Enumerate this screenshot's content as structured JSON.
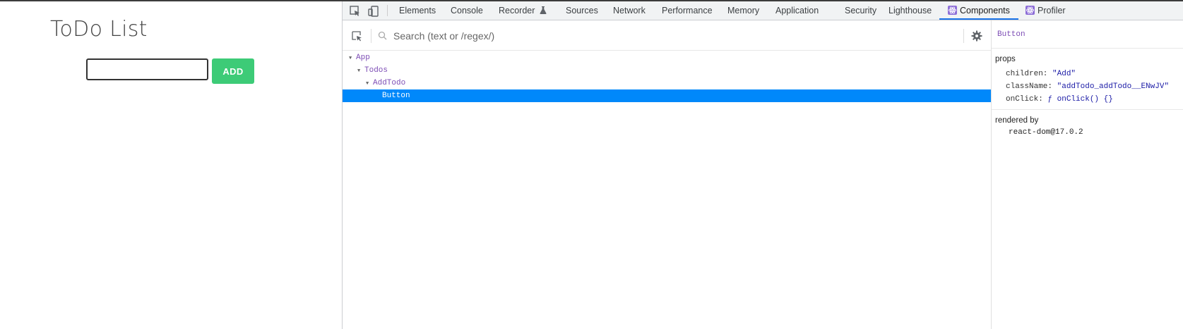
{
  "app": {
    "title": "ToDo List",
    "input_value": "",
    "add_label": "ADD",
    "accent_color": "#3dcb77"
  },
  "devtools": {
    "tabs": [
      {
        "label": "Elements"
      },
      {
        "label": "Console"
      },
      {
        "label": "Recorder"
      },
      {
        "label": "Sources"
      },
      {
        "label": "Network"
      },
      {
        "label": "Performance"
      },
      {
        "label": "Memory"
      },
      {
        "label": "Application"
      },
      {
        "label": "Security"
      },
      {
        "label": "Lighthouse"
      },
      {
        "label": "Components"
      },
      {
        "label": "Profiler"
      }
    ],
    "active_tab": "Components",
    "recorder_icon": "flask-icon",
    "search": {
      "placeholder": "Search (text or /regex/)"
    },
    "tree": [
      {
        "label": "App",
        "expanded": true
      },
      {
        "label": "Todos",
        "expanded": true
      },
      {
        "label": "AddTodo",
        "expanded": true
      },
      {
        "label": "Button",
        "selected": true
      }
    ],
    "selected_color": "#0088fa",
    "props_panel": {
      "component": "Button",
      "props_title": "props",
      "props": [
        {
          "key": "children:",
          "value": "\"Add\""
        },
        {
          "key": "className:",
          "value": "\"addTodo_addTodo__ENwJV\""
        },
        {
          "key": "onClick:",
          "value": "ƒ onClick() {}"
        }
      ],
      "rendered_by_title": "rendered by",
      "rendered_by": "react-dom@17.0.2"
    }
  }
}
